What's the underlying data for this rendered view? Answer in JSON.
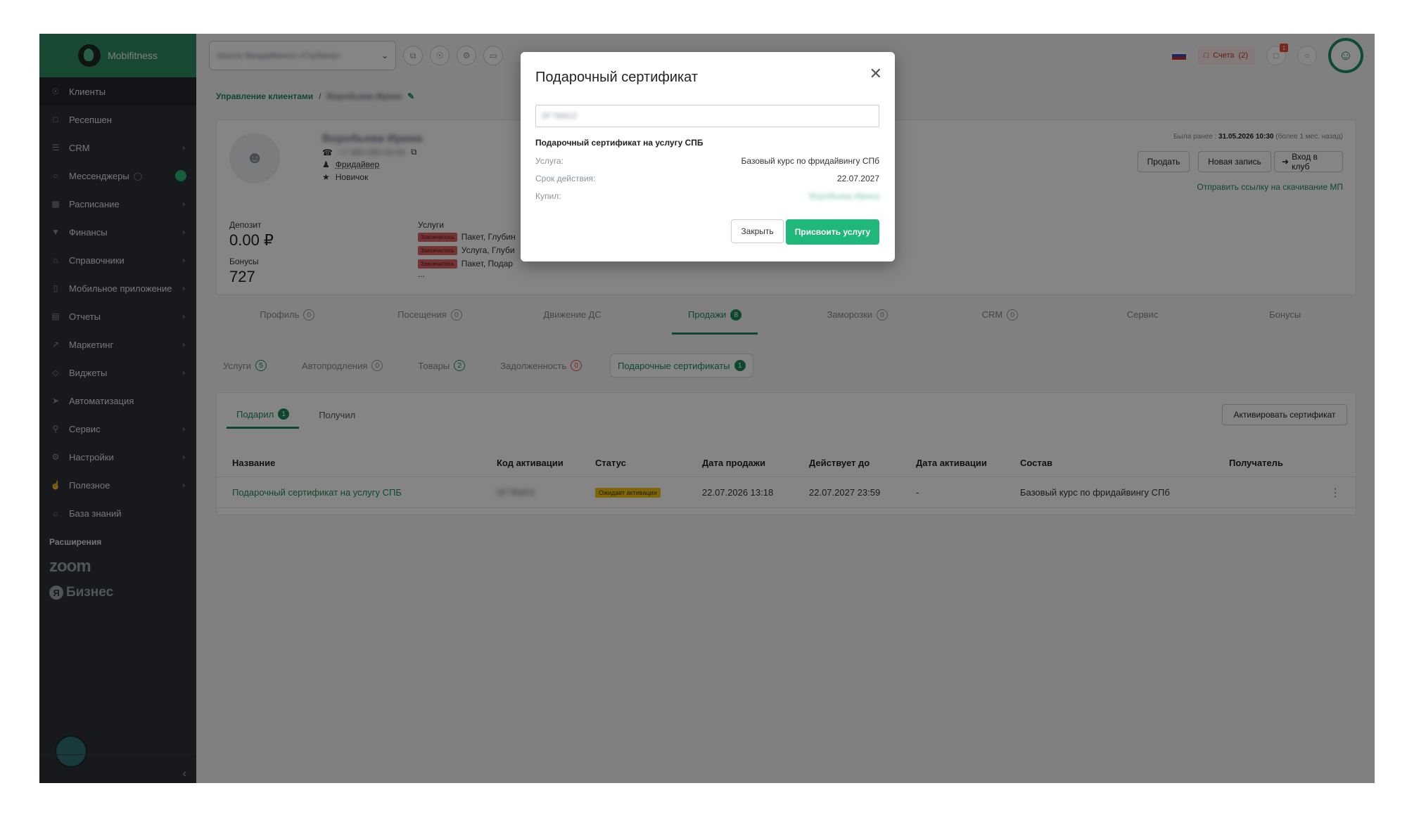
{
  "sidebar": {
    "brand": "Mobifitness",
    "items": [
      {
        "label": "Клиенты",
        "icon": "user-icon"
      },
      {
        "label": "Ресепшен",
        "icon": "clipboard-icon"
      },
      {
        "label": "CRM",
        "icon": "list-icon"
      },
      {
        "label": "Мессенджеры",
        "icon": "chat-icon"
      },
      {
        "label": "Расписание",
        "icon": "calendar-icon"
      },
      {
        "label": "Финансы",
        "icon": "cart-icon"
      },
      {
        "label": "Справочники",
        "icon": "home-icon"
      },
      {
        "label": "Мобильное приложение",
        "icon": "phone-icon"
      },
      {
        "label": "Отчеты",
        "icon": "report-icon"
      },
      {
        "label": "Маркетинг",
        "icon": "megaphone-icon"
      },
      {
        "label": "Виджеты",
        "icon": "tag-icon"
      },
      {
        "label": "Автоматизация",
        "icon": "rocket-icon"
      },
      {
        "label": "Сервис",
        "icon": "wrench-icon"
      },
      {
        "label": "Настройки",
        "icon": "gear-icon"
      },
      {
        "label": "Полезное",
        "icon": "thumbs-up-icon"
      },
      {
        "label": "База знаний",
        "icon": "globe-icon"
      }
    ],
    "extensions_label": "Расширения",
    "zoom_label": "zoom",
    "ya_label": "Я",
    "business_label": "Бизнес"
  },
  "topbar": {
    "club_select_value": "Школа Фридайвинга «Глубина»",
    "bills_label": "Счета",
    "bills_count": "(2)",
    "notif_badge": "1"
  },
  "breadcrumb": {
    "root": "Управление клиентами",
    "sep": "/",
    "current": "Воробьева Ирина"
  },
  "profile": {
    "name": "Воробьева Ирина",
    "phone": "+7 900 000-00-00",
    "role": "Фридайвер",
    "level": "Новичок",
    "deposit_label": "Депозит",
    "deposit_value": "0.00 ₽",
    "bonus_label": "Бонусы",
    "bonus_value": "727",
    "services_label": "Услуги",
    "services": [
      {
        "tag": "Закончилось",
        "text": "Пакет, Глубин"
      },
      {
        "tag": "Закончилось",
        "text": "Услуга, Глуби"
      },
      {
        "tag": "Закончилось",
        "text": "Пакет, Подар"
      }
    ],
    "services_more": "...",
    "last_visit_prefix": "Была ранее :",
    "last_visit_date": "31.05.2026 10:30",
    "last_visit_suffix": "(более 1 мес. назад)",
    "btn_sell": "Продать",
    "btn_new_record": "Новая запись",
    "btn_enter_club": "Вход в клуб",
    "link_app": "Отправить ссылку на скачивание МП"
  },
  "main_tabs": [
    {
      "label": "Профиль",
      "count": "0"
    },
    {
      "label": "Посещения",
      "count": "0"
    },
    {
      "label": "Движение ДС",
      "count": ""
    },
    {
      "label": "Продажи",
      "count": "8"
    },
    {
      "label": "Заморозки",
      "count": "0"
    },
    {
      "label": "CRM",
      "count": "0"
    },
    {
      "label": "Сервис",
      "count": ""
    },
    {
      "label": "Бонусы",
      "count": ""
    }
  ],
  "sub_tabs": [
    {
      "label": "Услуги",
      "count": "5"
    },
    {
      "label": "Автопродления",
      "count": "0"
    },
    {
      "label": "Товары",
      "count": "2"
    },
    {
      "label": "Задолженность",
      "count": "0"
    },
    {
      "label": "Подарочные сертификаты",
      "count": "1"
    }
  ],
  "cert_section": {
    "tab_gave": "Подарил",
    "tab_gave_count": "1",
    "tab_received": "Получил",
    "activate_btn": "Активировать сертификат",
    "columns": [
      "Название",
      "Код активации",
      "Статус",
      "Дата продажи",
      "Действует до",
      "Дата активации",
      "Состав",
      "Получатель"
    ],
    "row": {
      "name": "Подарочный сертификат на услугу СПБ",
      "code": "0F7B6D2",
      "status": "Ожидает активации",
      "sale_date": "22.07.2026 13:18",
      "valid_until": "22.07.2027 23:59",
      "activation_date": "-",
      "composition": "Базовый курс по фридайвингу СПб",
      "recipient": ""
    }
  },
  "modal": {
    "title": "Подарочный сертификат",
    "code_value": "0F7B6D2",
    "subtitle": "Подарочный сертификат на услугу СПБ",
    "service_key": "Услуга:",
    "service_value": "Базовый курс по фридайвингу СПб",
    "validity_key": "Срок действия:",
    "validity_value": "22.07.2027",
    "bought_key": "Купил:",
    "bought_value": "Воробьева Ирина",
    "btn_close": "Закрыть",
    "btn_assign": "Присвоить услугу"
  },
  "colors": {
    "brand_green": "#1e8a5a",
    "sidebar_bg": "#2c3037",
    "assign_button": "#20b77a",
    "ended_tag": "#e06464",
    "status_pending": "#f1c40f"
  }
}
